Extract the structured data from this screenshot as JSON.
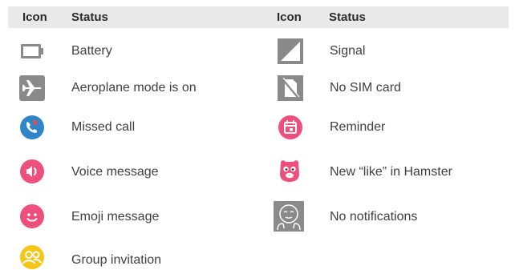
{
  "header": {
    "left_icon": "Icon",
    "left_status": "Status",
    "right_icon": "Icon",
    "right_status": "Status"
  },
  "left_rows": [
    {
      "icon": "battery-icon",
      "status": "Battery"
    },
    {
      "icon": "airplane-icon",
      "status": "Aeroplane mode is on"
    },
    {
      "icon": "missed-call-icon",
      "status": "Missed call"
    },
    {
      "icon": "voice-message-icon",
      "status": "Voice message"
    },
    {
      "icon": "emoji-message-icon",
      "status": "Emoji message"
    },
    {
      "icon": "group-invitation-icon",
      "status": "Group invitation"
    }
  ],
  "right_rows": [
    {
      "icon": "signal-icon",
      "status": "Signal"
    },
    {
      "icon": "no-sim-icon",
      "status": "No SIM card"
    },
    {
      "icon": "reminder-icon",
      "status": "Reminder"
    },
    {
      "icon": "hamster-like-icon",
      "status": "New “like” in Hamster"
    },
    {
      "icon": "no-notifications-icon",
      "status": "No notifications"
    }
  ],
  "colors": {
    "header_bg": "#e9e9e9",
    "icon_gray": "#8a8a8a",
    "icon_blue": "#2e86c9",
    "icon_pink": "#ef4f7d",
    "icon_yellow": "#f5c518"
  }
}
